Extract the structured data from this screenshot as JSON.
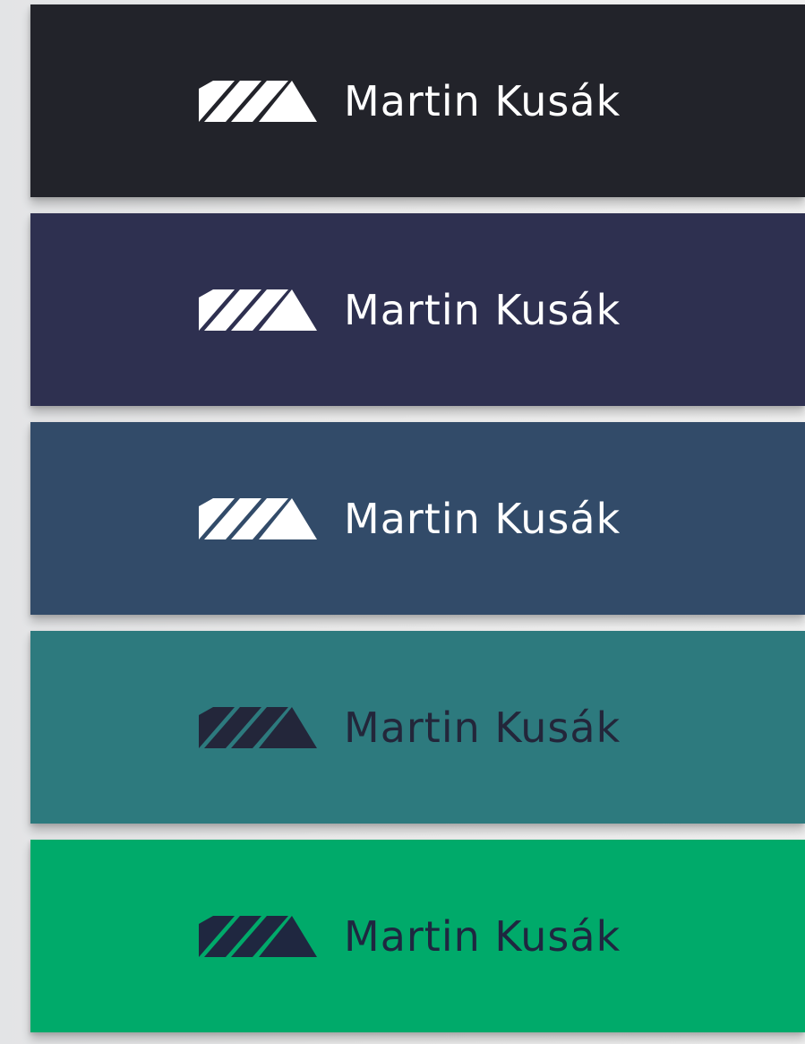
{
  "brand": {
    "name": "Martin Kusák",
    "mark_icon": "mk-logo-mark-icon"
  },
  "swatches": [
    {
      "background": "#22232a",
      "foreground": "#ffffff"
    },
    {
      "background": "#2e3050",
      "foreground": "#ffffff"
    },
    {
      "background": "#324b69",
      "foreground": "#ffffff"
    },
    {
      "background": "#2d7a7e",
      "foreground": "#23263a"
    },
    {
      "background": "#00aa6a",
      "foreground": "#1f2740"
    }
  ]
}
